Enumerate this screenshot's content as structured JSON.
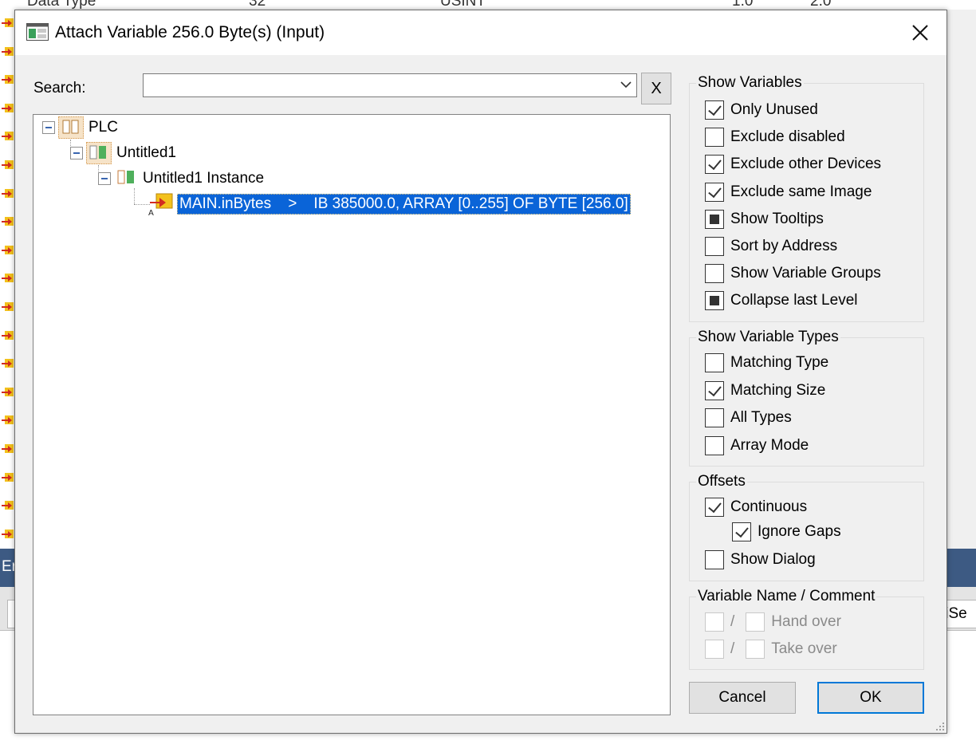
{
  "background": {
    "top_row": [
      "Data Type",
      "32",
      "USINT",
      "1.0",
      "2.0"
    ],
    "bar_label": "Er",
    "right_field": "liSe"
  },
  "dialog": {
    "title": "Attach Variable 256.0 Byte(s) (Input)",
    "close_glyph": "✕"
  },
  "search": {
    "label": "Search:",
    "value": "",
    "placeholder": "",
    "clear_label": "X"
  },
  "tree": {
    "root": "PLC",
    "project": "Untitled1",
    "instance": "Untitled1 Instance",
    "selected_variable": "MAIN.inBytes    >    IB 385000.0, ARRAY [0..255] OF BYTE [256.0]",
    "selected_marker": "A"
  },
  "show_variables": {
    "title": "Show Variables",
    "items": [
      {
        "label": "Only Unused",
        "state": "checked"
      },
      {
        "label": "Exclude disabled",
        "state": "unchecked"
      },
      {
        "label": "Exclude other Devices",
        "state": "checked"
      },
      {
        "label": "Exclude same Image",
        "state": "checked"
      },
      {
        "label": "Show Tooltips",
        "state": "indeterminate"
      },
      {
        "label": "Sort by Address",
        "state": "unchecked"
      },
      {
        "label": "Show Variable Groups",
        "state": "unchecked"
      },
      {
        "label": "Collapse last Level",
        "state": "indeterminate"
      }
    ]
  },
  "show_variable_types": {
    "title": "Show Variable Types",
    "items": [
      {
        "label": "Matching Type",
        "state": "unchecked"
      },
      {
        "label": "Matching Size",
        "state": "checked"
      },
      {
        "label": "All Types",
        "state": "unchecked"
      },
      {
        "label": "Array Mode",
        "state": "unchecked"
      }
    ]
  },
  "offsets": {
    "title": "Offsets",
    "continuous": {
      "label": "Continuous",
      "state": "checked"
    },
    "ignore_gaps": {
      "label": "Ignore Gaps",
      "state": "checked"
    },
    "show_dialog": {
      "label": "Show Dialog",
      "state": "unchecked"
    }
  },
  "variable_name_comment": {
    "title": "Variable Name / Comment",
    "separator": "/",
    "hand_over": "Hand over",
    "take_over": "Take over"
  },
  "buttons": {
    "cancel": "Cancel",
    "ok": "OK"
  }
}
